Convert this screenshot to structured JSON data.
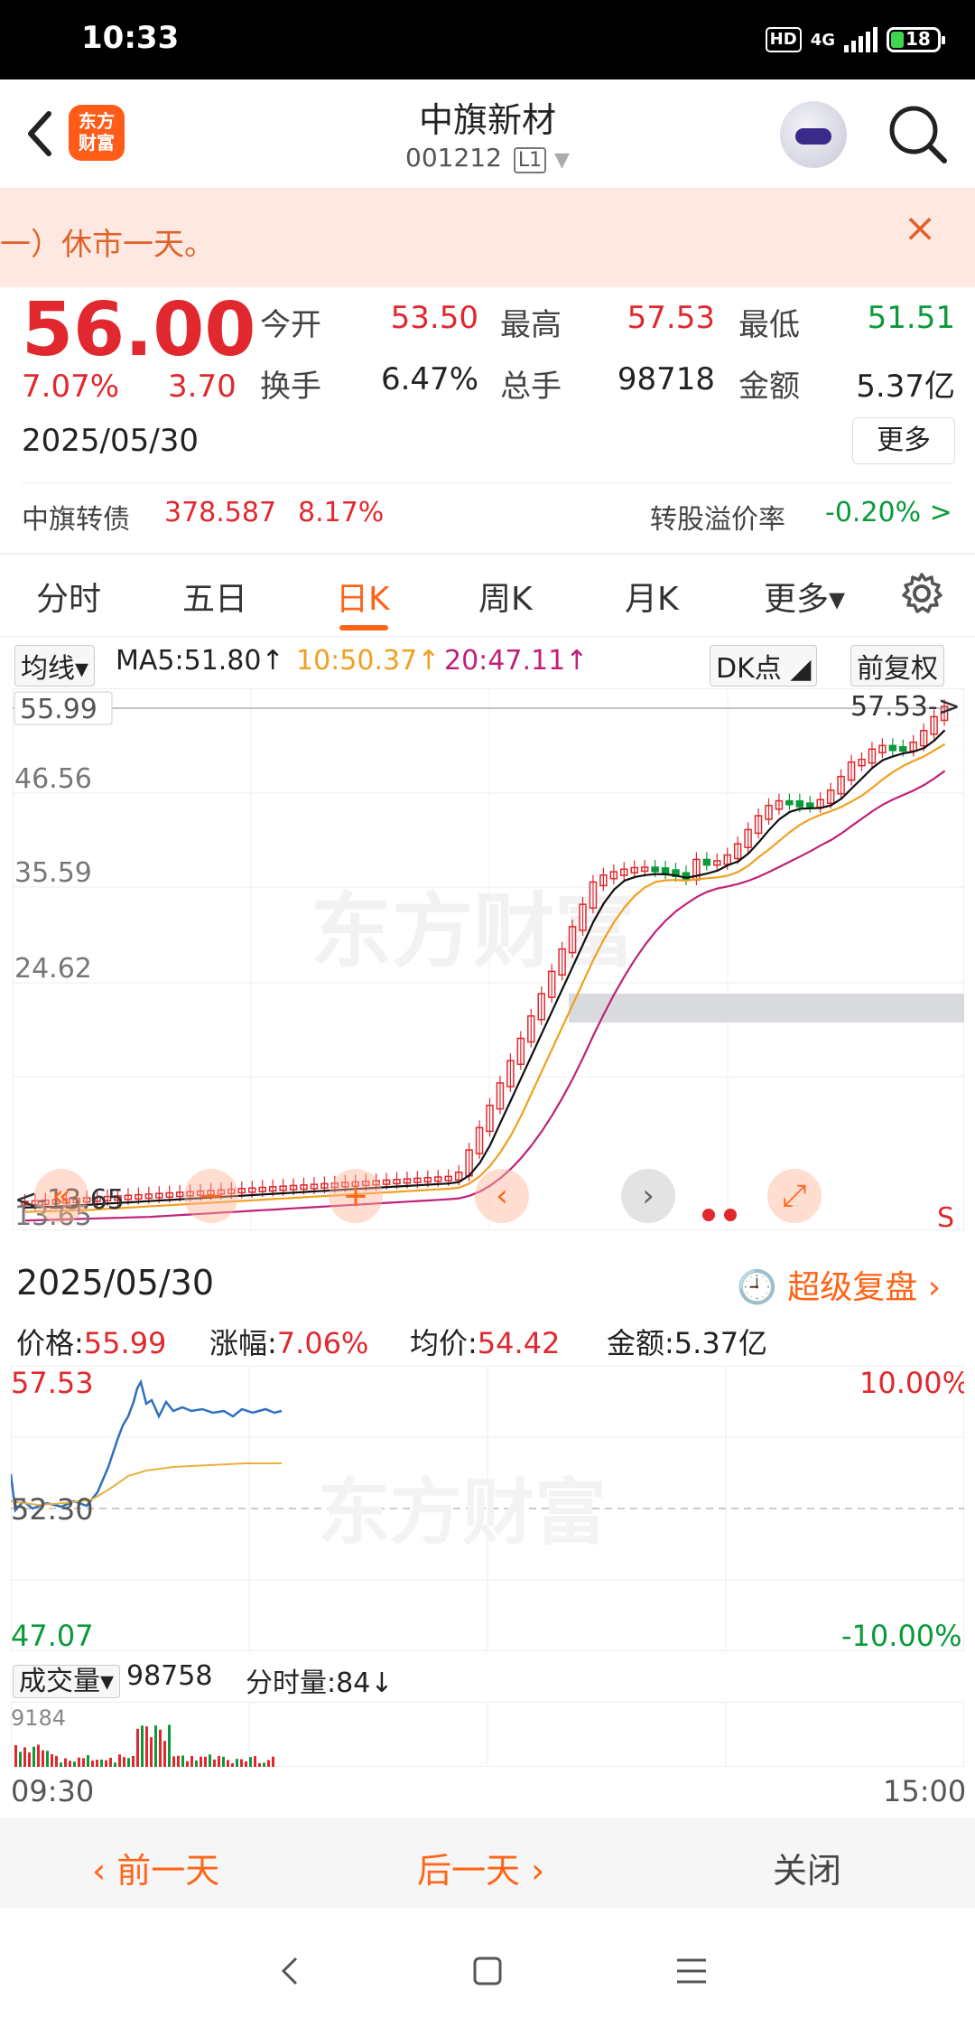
{
  "status_bar": {
    "time": "10:33",
    "hd": "HD",
    "net": "4G",
    "battery": "18"
  },
  "header": {
    "app_logo": "东方\n财富",
    "stock_name": "中旗新材",
    "stock_code": "001212",
    "level": "L1"
  },
  "notice": {
    "text": "一）休市一天。"
  },
  "quote": {
    "price": "56.00",
    "change_pct": "7.07%",
    "change": "3.70",
    "date": "2025/05/30",
    "open_label": "今开",
    "open": "53.50",
    "high_label": "最高",
    "high": "57.53",
    "low_label": "最低",
    "low": "51.51",
    "turnover_label": "换手",
    "turnover": "6.47%",
    "volume_label": "总手",
    "volume": "98718",
    "amount_label": "金额",
    "amount": "5.37亿",
    "more_label": "更多"
  },
  "bond": {
    "name": "中旗转债",
    "price": "378.587",
    "pct": "8.17%",
    "premium_label": "转股溢价率",
    "premium": "-0.20% >"
  },
  "tabs": [
    "分时",
    "五日",
    "日K",
    "周K",
    "月K",
    "更多▾"
  ],
  "active_tab": "日K",
  "ma": {
    "selector": "均线▾",
    "ma5": "MA5:51.80↑",
    "ma10": "10:50.37↑",
    "ma20": "20:47.11↑",
    "dk": "DK点",
    "adjust": "前复权"
  },
  "kline": {
    "y_labels": [
      "55.99",
      "46.56",
      "35.59",
      "24.62",
      "13.65"
    ],
    "max_marker": "57.53->",
    "min_marker": "<-13.65",
    "watermark": "东方财富",
    "s_marker": "S",
    "colors": {
      "up": "#e0282e",
      "down": "#0a9a3a",
      "ma5": "#111111",
      "ma10": "#f0a020",
      "ma20": "#c0207a"
    }
  },
  "intraday": {
    "date": "2025/05/30",
    "super_replay": "超级复盘",
    "price_label": "价格:",
    "price": "55.99",
    "pct_label": "涨幅:",
    "pct": "7.06%",
    "avg_label": "均价:",
    "avg": "54.42",
    "amount_label": "金额:",
    "amount": "5.37亿",
    "y_top": "57.53",
    "y_mid": "52.30",
    "y_bot": "47.07",
    "pct_top": "10.00%",
    "pct_bot": "-10.00%",
    "watermark": "东方财富",
    "vol_selector": "成交量▾",
    "vol_total": "98758",
    "tick_vol": "分时量:84↓",
    "vol_max": "9184",
    "time_start": "09:30",
    "time_end": "15:00"
  },
  "day_nav": {
    "prev": "前一天",
    "next": "后一天",
    "close": "关闭"
  }
}
